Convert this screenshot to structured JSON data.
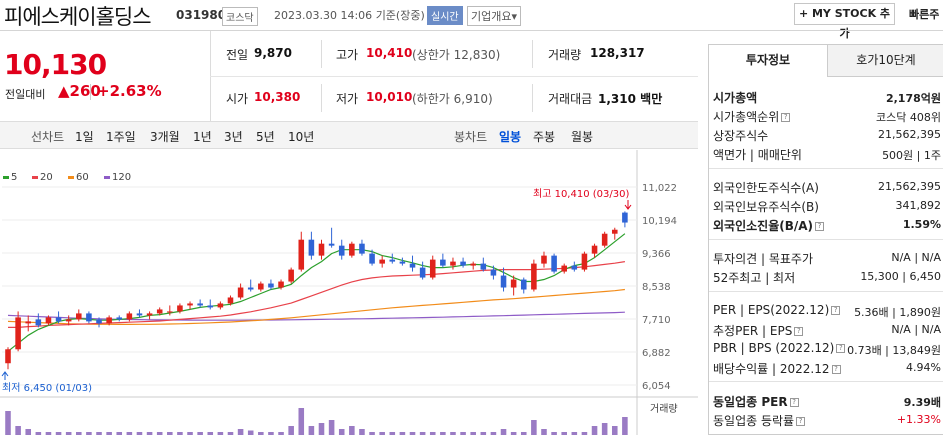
{
  "header": {
    "name": "피에스케이홀딩스",
    "code": "031980",
    "market_badge": "코스닥",
    "datetime": "2023.03.30 14:06",
    "basis": "기준(장중)",
    "realtime_badge": "실시간",
    "company_overview": "기업개요",
    "company_overview_arrow": "▾",
    "my_stock_button": "+ MY STOCK 추가",
    "quick_order": "빠른주"
  },
  "price": {
    "current": "10,130",
    "change_label": "전일대비",
    "change_arrow": "▲",
    "change": "260",
    "change_pct": "+2.63%"
  },
  "quote": {
    "prev_close_label": "전일",
    "prev_close": "9,870",
    "high_label": "고가",
    "high": "10,410",
    "upper_limit": "(상한가 12,830)",
    "volume_label": "거래량",
    "volume": "128,317",
    "open_label": "시가",
    "open": "10,380",
    "low_label": "저가",
    "low": "10,010",
    "lower_limit": "(하한가 6,910)",
    "amount_label": "거래대금",
    "amount": "1,310",
    "amount_unit": "백만"
  },
  "period_bar": {
    "line_chart": "선차트",
    "line_periods": [
      "1일",
      "1주일",
      "3개월",
      "1년",
      "3년",
      "5년",
      "10년"
    ],
    "candle_chart": "봉차트",
    "candle_periods": [
      "일봉",
      "주봉",
      "월봉"
    ],
    "active_candle": "일봉"
  },
  "chart_data": {
    "type": "candlestick",
    "moving_averages": [
      {
        "name": "5",
        "color": "#2ca02c"
      },
      {
        "name": "20",
        "color": "#e8424a"
      },
      {
        "name": "60",
        "color": "#f28c1a"
      },
      {
        "name": "120",
        "color": "#8e5cc7"
      }
    ],
    "y_ticks": [
      "11,022",
      "10,194",
      "9,366",
      "8,538",
      "7,710",
      "6,882",
      "6,054"
    ],
    "ylim": [
      6054,
      11022
    ],
    "annotations": {
      "high": "최고 10,410 (03/30)",
      "low": "최저 6,450 (01/03)"
    },
    "volume_label": "거래량",
    "candles": [
      {
        "o": 6600,
        "h": 7000,
        "l": 6450,
        "c": 6950
      },
      {
        "o": 6950,
        "h": 7900,
        "l": 6900,
        "c": 7750
      },
      {
        "o": 7600,
        "h": 7800,
        "l": 7400,
        "c": 7650
      },
      {
        "o": 7700,
        "h": 7850,
        "l": 7500,
        "c": 7550
      },
      {
        "o": 7600,
        "h": 7800,
        "l": 7550,
        "c": 7750
      },
      {
        "o": 7750,
        "h": 7900,
        "l": 7600,
        "c": 7650
      },
      {
        "o": 7650,
        "h": 7800,
        "l": 7550,
        "c": 7700
      },
      {
        "o": 7700,
        "h": 7950,
        "l": 7650,
        "c": 7850
      },
      {
        "o": 7850,
        "h": 7900,
        "l": 7600,
        "c": 7650
      },
      {
        "o": 7700,
        "h": 7750,
        "l": 7500,
        "c": 7600
      },
      {
        "o": 7600,
        "h": 7800,
        "l": 7550,
        "c": 7750
      },
      {
        "o": 7750,
        "h": 7800,
        "l": 7650,
        "c": 7700
      },
      {
        "o": 7700,
        "h": 7900,
        "l": 7650,
        "c": 7850
      },
      {
        "o": 7850,
        "h": 7950,
        "l": 7750,
        "c": 7800
      },
      {
        "o": 7800,
        "h": 7900,
        "l": 7700,
        "c": 7850
      },
      {
        "o": 7850,
        "h": 8000,
        "l": 7800,
        "c": 7950
      },
      {
        "o": 7900,
        "h": 8050,
        "l": 7800,
        "c": 7900
      },
      {
        "o": 7900,
        "h": 8100,
        "l": 7850,
        "c": 8050
      },
      {
        "o": 8050,
        "h": 8150,
        "l": 7950,
        "c": 8100
      },
      {
        "o": 8100,
        "h": 8200,
        "l": 8000,
        "c": 8050
      },
      {
        "o": 8050,
        "h": 8200,
        "l": 7950,
        "c": 8000
      },
      {
        "o": 8000,
        "h": 8150,
        "l": 7950,
        "c": 8100
      },
      {
        "o": 8100,
        "h": 8300,
        "l": 8050,
        "c": 8250
      },
      {
        "o": 8250,
        "h": 8600,
        "l": 8200,
        "c": 8500
      },
      {
        "o": 8500,
        "h": 8700,
        "l": 8400,
        "c": 8450
      },
      {
        "o": 8450,
        "h": 8650,
        "l": 8400,
        "c": 8600
      },
      {
        "o": 8600,
        "h": 8700,
        "l": 8450,
        "c": 8500
      },
      {
        "o": 8500,
        "h": 8700,
        "l": 8450,
        "c": 8650
      },
      {
        "o": 8650,
        "h": 9000,
        "l": 8600,
        "c": 8950
      },
      {
        "o": 8950,
        "h": 9900,
        "l": 8900,
        "c": 9700
      },
      {
        "o": 9700,
        "h": 9900,
        "l": 9200,
        "c": 9300
      },
      {
        "o": 9300,
        "h": 9700,
        "l": 9200,
        "c": 9600
      },
      {
        "o": 9600,
        "h": 10000,
        "l": 9500,
        "c": 9550
      },
      {
        "o": 9550,
        "h": 9700,
        "l": 9200,
        "c": 9300
      },
      {
        "o": 9300,
        "h": 9650,
        "l": 9250,
        "c": 9600
      },
      {
        "o": 9600,
        "h": 9700,
        "l": 9300,
        "c": 9350
      },
      {
        "o": 9350,
        "h": 9450,
        "l": 9050,
        "c": 9100
      },
      {
        "o": 9100,
        "h": 9300,
        "l": 9000,
        "c": 9200
      },
      {
        "o": 9200,
        "h": 9350,
        "l": 9100,
        "c": 9150
      },
      {
        "o": 9150,
        "h": 9250,
        "l": 9050,
        "c": 9100
      },
      {
        "o": 9100,
        "h": 9300,
        "l": 8900,
        "c": 9000
      },
      {
        "o": 9000,
        "h": 9150,
        "l": 8700,
        "c": 8750
      },
      {
        "o": 8750,
        "h": 9300,
        "l": 8700,
        "c": 9200
      },
      {
        "o": 9200,
        "h": 9350,
        "l": 9000,
        "c": 9050
      },
      {
        "o": 9050,
        "h": 9250,
        "l": 8950,
        "c": 9150
      },
      {
        "o": 9150,
        "h": 9250,
        "l": 9000,
        "c": 9050
      },
      {
        "o": 9050,
        "h": 9150,
        "l": 8950,
        "c": 9100
      },
      {
        "o": 9100,
        "h": 9250,
        "l": 8900,
        "c": 8950
      },
      {
        "o": 8950,
        "h": 9050,
        "l": 8700,
        "c": 8800
      },
      {
        "o": 8800,
        "h": 9000,
        "l": 8400,
        "c": 8500
      },
      {
        "o": 8500,
        "h": 8800,
        "l": 8300,
        "c": 8700
      },
      {
        "o": 8700,
        "h": 8750,
        "l": 8350,
        "c": 8450
      },
      {
        "o": 8450,
        "h": 9200,
        "l": 8400,
        "c": 9100
      },
      {
        "o": 9100,
        "h": 9400,
        "l": 9000,
        "c": 9300
      },
      {
        "o": 9300,
        "h": 9350,
        "l": 8850,
        "c": 8900
      },
      {
        "o": 8900,
        "h": 9100,
        "l": 8850,
        "c": 9050
      },
      {
        "o": 9050,
        "h": 9150,
        "l": 8900,
        "c": 8950
      },
      {
        "o": 8950,
        "h": 9400,
        "l": 8900,
        "c": 9350
      },
      {
        "o": 9350,
        "h": 9600,
        "l": 9250,
        "c": 9550
      },
      {
        "o": 9550,
        "h": 9900,
        "l": 9500,
        "c": 9850
      },
      {
        "o": 9850,
        "h": 10000,
        "l": 9700,
        "c": 9950
      },
      {
        "o": 10380,
        "h": 10410,
        "l": 10010,
        "c": 10130
      }
    ],
    "ma5": [
      6900,
      7100,
      7300,
      7450,
      7550,
      7650,
      7700,
      7720,
      7700,
      7680,
      7680,
      7700,
      7720,
      7750,
      7800,
      7820,
      7860,
      7900,
      7950,
      8000,
      8030,
      8050,
      8080,
      8150,
      8250,
      8350,
      8450,
      8500,
      8580,
      8800,
      9000,
      9150,
      9350,
      9450,
      9450,
      9450,
      9400,
      9300,
      9250,
      9180,
      9120,
      9050,
      9000,
      9000,
      9020,
      9060,
      9080,
      9070,
      9000,
      8880,
      8750,
      8650,
      8650,
      8700,
      8800,
      8950,
      9050,
      9100,
      9250,
      9450,
      9650,
      9850
    ],
    "ma20": [
      7500,
      7500,
      7520,
      7530,
      7550,
      7560,
      7570,
      7580,
      7590,
      7600,
      7610,
      7620,
      7630,
      7640,
      7650,
      7660,
      7680,
      7700,
      7720,
      7740,
      7760,
      7780,
      7810,
      7850,
      7890,
      7940,
      7990,
      8050,
      8110,
      8200,
      8290,
      8380,
      8470,
      8560,
      8640,
      8700,
      8740,
      8770,
      8790,
      8800,
      8810,
      8820,
      8830,
      8850,
      8870,
      8890,
      8910,
      8930,
      8940,
      8950,
      8950,
      8950,
      8950,
      8960,
      8970,
      8980,
      9000,
      9020,
      9050,
      9080,
      9110,
      9150
    ],
    "ma60": [
      7650,
      7640,
      7630,
      7620,
      7610,
      7600,
      7590,
      7585,
      7580,
      7578,
      7576,
      7575,
      7575,
      7576,
      7578,
      7580,
      7585,
      7590,
      7597,
      7605,
      7614,
      7624,
      7635,
      7650,
      7665,
      7680,
      7700,
      7720,
      7740,
      7765,
      7790,
      7815,
      7840,
      7865,
      7890,
      7915,
      7940,
      7965,
      7990,
      8010,
      8030,
      8050,
      8070,
      8090,
      8110,
      8130,
      8150,
      8170,
      8190,
      8205,
      8220,
      8240,
      8260,
      8280,
      8300,
      8320,
      8340,
      8360,
      8380,
      8400,
      8420,
      8450
    ],
    "ma120": [
      7800,
      7790,
      7780,
      7770,
      7760,
      7750,
      7740,
      7730,
      7722,
      7715,
      7708,
      7702,
      7698,
      7694,
      7690,
      7688,
      7686,
      7684,
      7682,
      7681,
      7680,
      7680,
      7680,
      7681,
      7682,
      7684,
      7686,
      7688,
      7691,
      7694,
      7697,
      7700,
      7704,
      7708,
      7712,
      7716,
      7720,
      7724,
      7729,
      7734,
      7739,
      7744,
      7750,
      7756,
      7762,
      7768,
      7774,
      7780,
      7787,
      7794,
      7801,
      7808,
      7815,
      7822,
      7829,
      7836,
      7843,
      7850,
      7857,
      7864,
      7871,
      7880
    ],
    "volumes": [
      0.8,
      0.3,
      0.2,
      0.1,
      0.1,
      0.1,
      0.1,
      0.1,
      0.1,
      0.1,
      0.1,
      0.1,
      0.1,
      0.1,
      0.1,
      0.1,
      0.1,
      0.1,
      0.1,
      0.1,
      0.1,
      0.1,
      0.1,
      0.2,
      0.15,
      0.1,
      0.1,
      0.1,
      0.3,
      0.9,
      0.3,
      0.4,
      0.5,
      0.2,
      0.3,
      0.2,
      0.1,
      0.1,
      0.1,
      0.1,
      0.1,
      0.1,
      0.1,
      0.1,
      0.1,
      0.1,
      0.1,
      0.1,
      0.1,
      0.2,
      0.1,
      0.1,
      0.5,
      0.2,
      0.1,
      0.1,
      0.1,
      0.1,
      0.3,
      0.4,
      0.3,
      0.6
    ]
  },
  "invest_panel": {
    "tab_active": "투자정보",
    "tab_inactive": "호가10단계",
    "rows1": [
      {
        "label": "시가총액",
        "value": "2,178억원",
        "bold": true
      },
      {
        "label": "시가총액순위",
        "value": "코스닥 408위",
        "icon": true
      },
      {
        "label": "상장주식수",
        "value": "21,562,395"
      },
      {
        "label": "액면가 | 매매단위",
        "value": "500원 | 1주"
      }
    ],
    "rows2": [
      {
        "label": "외국인한도주식수(A)",
        "value": "21,562,395"
      },
      {
        "label": "외국인보유주식수(B)",
        "value": "341,892"
      },
      {
        "label": "외국인소진율(B/A)",
        "value": "1.59%",
        "bold": true,
        "icon": true
      }
    ],
    "rows3": [
      {
        "label": "투자의견 | 목표주가",
        "value": "N/A | N/A"
      },
      {
        "label": "52주최고 | 최저",
        "value": "15,300 | 6,450"
      }
    ],
    "rows4": [
      {
        "label": "PER | EPS(2022.12)",
        "value": "5.36배 | 1,890원",
        "icon": true
      },
      {
        "label": "추정PER | EPS",
        "value": "N/A | N/A",
        "icon": true
      },
      {
        "label": "PBR | BPS (2022.12)",
        "value": "0.73배 | 13,849원",
        "icon": true
      },
      {
        "label": "배당수익률 | 2022.12",
        "value": "4.94%",
        "icon": true
      }
    ],
    "rows5": [
      {
        "label": "동일업종 PER",
        "value": "9.39배",
        "bold": true,
        "icon": true
      },
      {
        "label": "동일업종 등락률",
        "value": "+1.33%",
        "red": true,
        "icon": true
      }
    ]
  }
}
